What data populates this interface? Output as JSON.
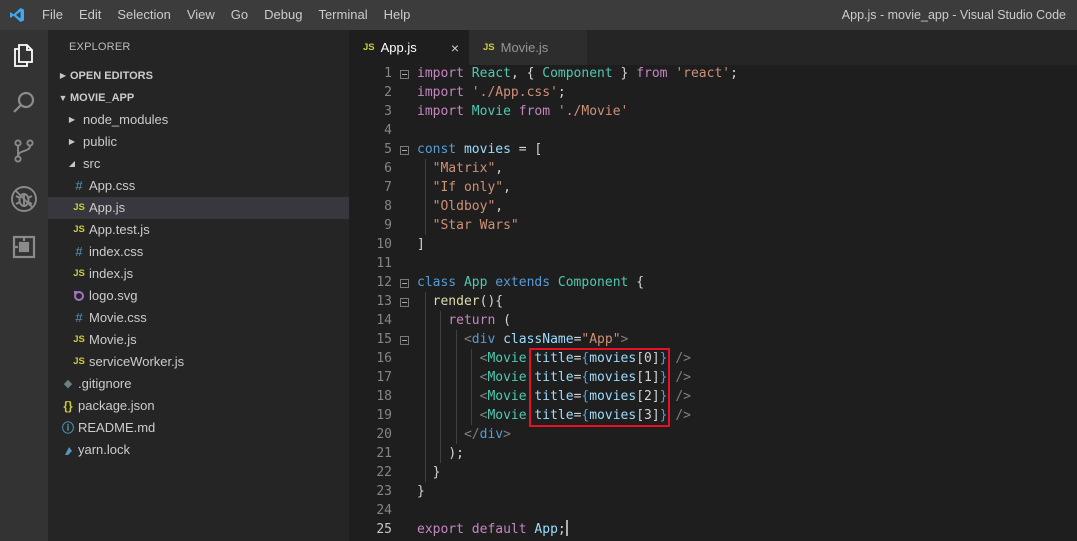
{
  "titlebar": {
    "menu": [
      "File",
      "Edit",
      "Selection",
      "View",
      "Go",
      "Debug",
      "Terminal",
      "Help"
    ],
    "window_title": "App.js - movie_app - Visual Studio Code"
  },
  "activitybar": {
    "icons": [
      "files-icon",
      "search-icon",
      "source-control-icon",
      "debug-icon",
      "extensions-icon"
    ]
  },
  "explorer": {
    "title": "EXPLORER",
    "open_editors": "OPEN EDITORS",
    "project": "MOVIE_APP",
    "tree": [
      {
        "label": "node_modules",
        "type": "folder",
        "state": "collapsed"
      },
      {
        "label": "public",
        "type": "folder",
        "state": "collapsed"
      },
      {
        "label": "src",
        "type": "folder",
        "state": "expanded"
      },
      {
        "label": "App.css",
        "type": "css",
        "icon": "#"
      },
      {
        "label": "App.js",
        "type": "js",
        "icon": "JS",
        "selected": true
      },
      {
        "label": "App.test.js",
        "type": "js",
        "icon": "JS"
      },
      {
        "label": "index.css",
        "type": "css",
        "icon": "#"
      },
      {
        "label": "index.js",
        "type": "js",
        "icon": "JS"
      },
      {
        "label": "logo.svg",
        "type": "svg",
        "icon": "◪"
      },
      {
        "label": "Movie.css",
        "type": "css",
        "icon": "#"
      },
      {
        "label": "Movie.js",
        "type": "js",
        "icon": "JS"
      },
      {
        "label": "serviceWorker.js",
        "type": "js",
        "icon": "JS"
      },
      {
        "label": ".gitignore",
        "type": "git",
        "icon": "◆"
      },
      {
        "label": "package.json",
        "type": "json",
        "icon": "{}"
      },
      {
        "label": "README.md",
        "type": "info",
        "icon": "ⓘ"
      },
      {
        "label": "yarn.lock",
        "type": "yarn",
        "icon": "🧶"
      }
    ]
  },
  "tabs": [
    {
      "icon": "JS",
      "label": "App.js",
      "active": true,
      "close": "×"
    },
    {
      "icon": "JS",
      "label": "Movie.js",
      "active": false
    }
  ],
  "editor": {
    "current_line": 25,
    "lines": [
      "import React, { Component } from 'react';",
      "import './App.css';",
      "import Movie from './Movie'",
      "",
      "const movies = [",
      "  \"Matrix\",",
      "  \"If only\",",
      "  \"Oldboy\",",
      "  \"Star Wars\"",
      "]",
      "",
      "class App extends Component {",
      "  render(){",
      "    return (",
      "      <div className=\"App\">",
      "        <Movie title={movies[0]} />",
      "        <Movie title={movies[1]} />",
      "        <Movie title={movies[2]} />",
      "        <Movie title={movies[3]} />",
      "      </div>",
      "    );",
      "  }",
      "}",
      "",
      "export default App;"
    ]
  },
  "colors": {
    "highlight_box": "#e81123",
    "js_icon": "#cbcb41",
    "css_icon": "#519aba"
  }
}
